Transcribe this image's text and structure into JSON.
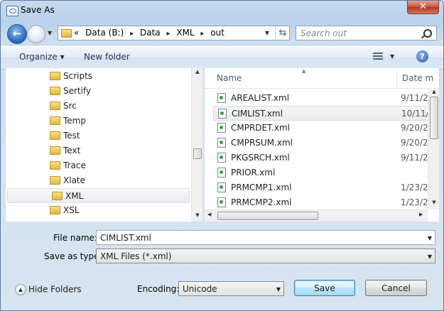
{
  "window": {
    "title": "Save As",
    "close_glyph": "✕"
  },
  "nav": {
    "back_glyph": "←",
    "breadcrumb_lead": "«",
    "breadcrumbs": [
      "Data (B:)",
      "Data",
      "XML",
      "out"
    ],
    "separator": "▸",
    "search_placeholder": "Search out"
  },
  "toolbar": {
    "organize": "Organize ▾",
    "new_folder": "New folder",
    "help": "?"
  },
  "tree": {
    "items": [
      "Scripts",
      "Sertify",
      "Src",
      "Temp",
      "Test",
      "Text",
      "Trace",
      "Xlate",
      "XML",
      "XSL"
    ],
    "selected": "XML"
  },
  "files": {
    "col_name": "Name",
    "col_date": "Date m",
    "rows": [
      {
        "name": "AREALIST.xml",
        "date": "9/11/2"
      },
      {
        "name": "CIMLIST.xml",
        "date": "10/11/."
      },
      {
        "name": "CMPRDET.xml",
        "date": "9/20/2"
      },
      {
        "name": "CMPRSUM.xml",
        "date": "9/20/2"
      },
      {
        "name": "PKGSRCH.xml",
        "date": "9/11/2"
      },
      {
        "name": "PRIOR.xml",
        "date": ""
      },
      {
        "name": "PRMCMP1.xml",
        "date": "1/23/2"
      },
      {
        "name": "PRMCMP2.xml",
        "date": "1/23/2"
      }
    ],
    "selected": "CIMLIST.xml"
  },
  "form": {
    "file_name_label": "File name:",
    "file_name_value": "CIMLIST.xml",
    "save_type_label": "Save as type:",
    "save_type_value": "XML Files (*.xml)"
  },
  "footer": {
    "hide_folders": "Hide Folders",
    "encoding_label": "Encoding:",
    "encoding_value": "Unicode",
    "save": "Save",
    "cancel": "Cancel"
  }
}
